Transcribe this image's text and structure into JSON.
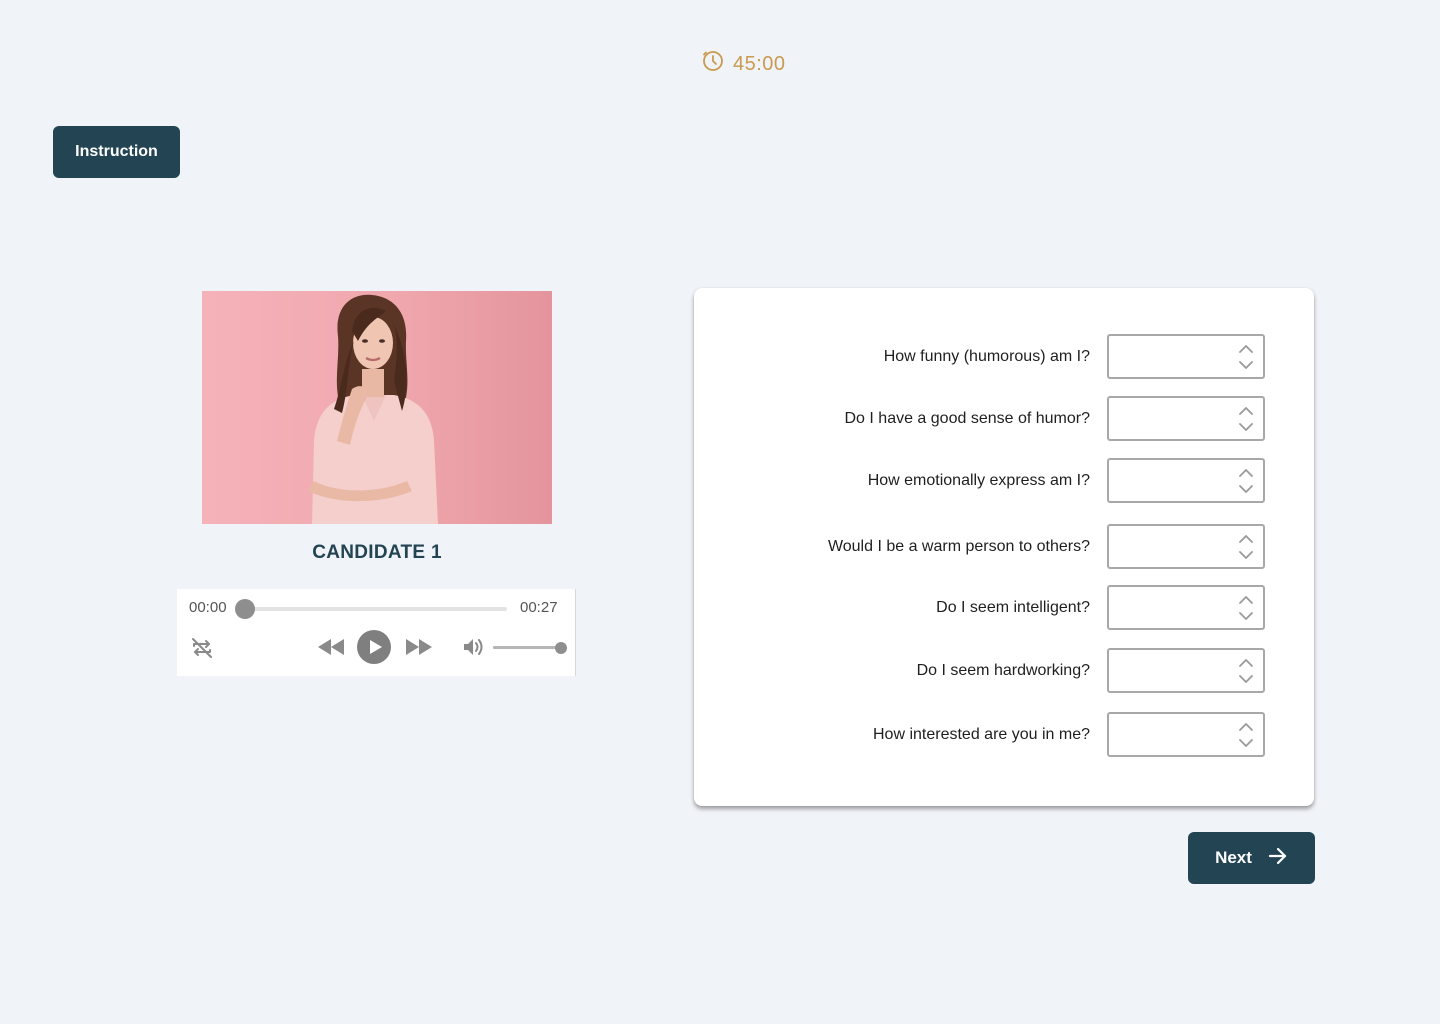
{
  "timer": {
    "value": "45:00",
    "icon": "clock-icon",
    "color": "#c99a4f"
  },
  "instruction_button": {
    "label": "Instruction"
  },
  "candidate": {
    "label": "CANDIDATE 1",
    "photo": "candidate-photo"
  },
  "player": {
    "current_time": "00:00",
    "total_time": "00:27",
    "progress": 0,
    "volume": 1.0
  },
  "questions": [
    {
      "label": "How funny (humorous) am I?",
      "value": ""
    },
    {
      "label": "Do I have a good sense of humor?",
      "value": ""
    },
    {
      "label": "How emotionally express am I?",
      "value": ""
    },
    {
      "label": "Would I be a warm person to others?",
      "value": ""
    },
    {
      "label": "Do I seem intelligent?",
      "value": ""
    },
    {
      "label": "Do I seem hardworking?",
      "value": ""
    },
    {
      "label": "How interested are you in me?",
      "value": ""
    }
  ],
  "next_button": {
    "label": "Next",
    "icon": "arrow-right-icon"
  },
  "colors": {
    "primary": "#224453",
    "background": "#f0f3f8",
    "accent": "#c99a4f"
  }
}
